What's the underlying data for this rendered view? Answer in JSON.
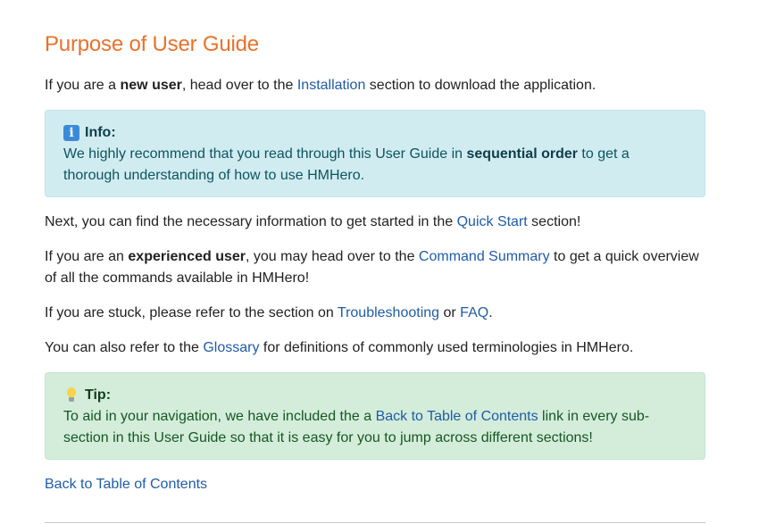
{
  "heading": "Purpose of User Guide",
  "intro": {
    "before": "If you are a ",
    "bold": "new user",
    "middle": ", head over to the ",
    "link": "Installation",
    "after": " section to download the application."
  },
  "info_box": {
    "title": "Info:",
    "icon": "info-icon",
    "before": "We highly recommend that you read through this User Guide in ",
    "bold": "sequential order",
    "after": " to get a thorough understanding of how to use HMHero."
  },
  "next": {
    "before": "Next, you can find the necessary information to get started in the ",
    "link": "Quick Start",
    "after": " section!"
  },
  "experienced": {
    "before": "If you are an ",
    "bold": "experienced user",
    "middle": ", you may head over to the ",
    "link": "Command Summary",
    "after": " to get a quick overview of all the commands available in HMHero!"
  },
  "stuck": {
    "before": "If you are stuck, please refer to the section on ",
    "link1": "Troubleshooting",
    "middle": " or ",
    "link2": "FAQ",
    "after": "."
  },
  "glossary": {
    "before": "You can also refer to the ",
    "link": "Glossary",
    "after": " for definitions of commonly used terminologies in HMHero."
  },
  "tip_box": {
    "title": "Tip:",
    "icon": "lightbulb-icon",
    "before": "To aid in your navigation, we have included the a ",
    "link": "Back to Table of Contents",
    "after": " link in every sub-section in this User Guide so that it is easy for you to jump across different sections!"
  },
  "back_link": "Back to Table of Contents",
  "colors": {
    "heading": "#e8722b",
    "link": "#1f5ca8",
    "info_bg": "#d1ecf1",
    "tip_bg": "#d4edda"
  }
}
